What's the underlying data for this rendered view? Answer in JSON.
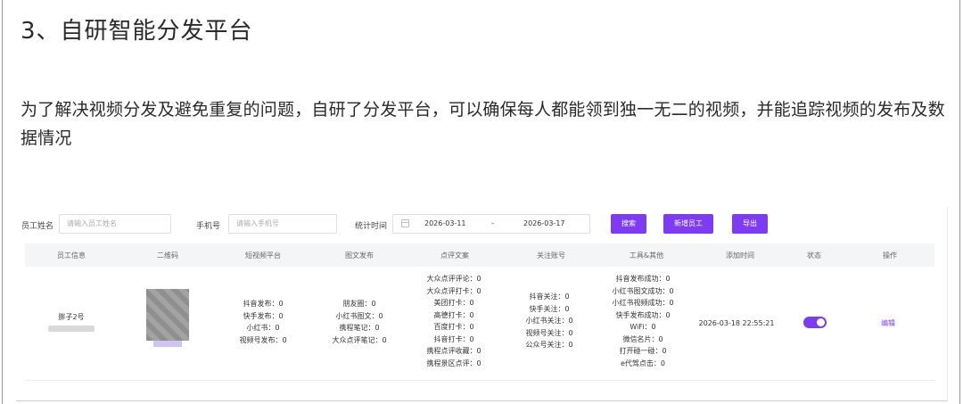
{
  "section": {
    "title": "3、自研智能分发平台",
    "intro": "为了解决视频分发及避免重复的问题，自研了分发平台，可以确保每人都能领到独一无二的视频，并能追踪视频的发布及数据情况"
  },
  "search": {
    "employee_name_label": "员工姓名",
    "employee_name_placeholder": "请输入员工姓名",
    "phone_label": "手机号",
    "phone_placeholder": "请输入手机号",
    "stats_time_label": "统计时间",
    "date_start": "2026-03-11",
    "date_separator": "-",
    "date_end": "2026-03-17",
    "search_button": "搜索",
    "add_employee_button": "新增员工",
    "export_button": "导出"
  },
  "table": {
    "headers": [
      "员工信息",
      "二维码",
      "短视频平台",
      "图文发布",
      "点评文案",
      "关注账号",
      "工具&其他",
      "添加时间",
      "状态",
      "操作"
    ],
    "row": {
      "employee_name": "胖子2号",
      "short_video": [
        "抖音发布：0",
        "快手发布：0",
        "小红书：0",
        "视频号发布：0"
      ],
      "image_text": [
        "朋友圈：0",
        "小红书图文：0",
        "携程笔记：0",
        "大众点评笔记：0"
      ],
      "review_copy": [
        "大众点评评论：0",
        "大众点评打卡：0",
        "美团打卡：0",
        "高德打卡：0",
        "百度打卡：0",
        "抖音打卡：0",
        "携程点评收藏：0",
        "携程景区点评：0"
      ],
      "follow_accounts": [
        "抖音关注：0",
        "快手关注：0",
        "小红书关注：0",
        "视频号关注：0",
        "公众号关注：0"
      ],
      "tools_other": [
        "抖音发布成功：0",
        "小红书图文成功：0",
        "小红书视频成功：0",
        "快手发布成功：0",
        "WiFi：0",
        "微信名片：0",
        "打开碰一碰：0",
        "e代驾点击：0"
      ],
      "added_time": "2026-03-18 22:55:21",
      "status_on": true,
      "action": "编辑"
    }
  },
  "colors": {
    "accent": "#7d3cf2"
  }
}
